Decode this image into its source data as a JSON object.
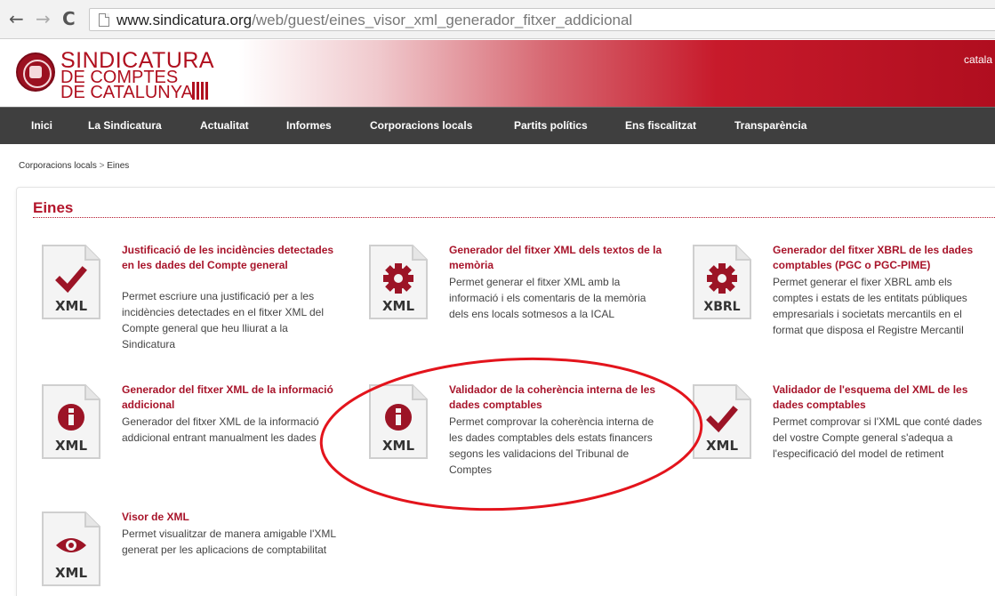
{
  "browser": {
    "back_glyph": "←",
    "forward_glyph": "→",
    "reload_glyph": "C",
    "url_host": "www.sindicatura.org",
    "url_path": "/web/guest/eines_visor_xml_generador_fitxer_addicional"
  },
  "header": {
    "logo_line1": "SINDICATURA",
    "logo_line2": "DE COMPTES",
    "logo_line3": "DE CATALUNYA",
    "language": "catala"
  },
  "nav": {
    "items": [
      {
        "label": "Inici"
      },
      {
        "label": "La Sindicatura"
      },
      {
        "label": "Actualitat"
      },
      {
        "label": "Informes"
      },
      {
        "label": "Corporacions locals"
      },
      {
        "label": "Partits polítics"
      },
      {
        "label": "Ens fiscalitzat"
      },
      {
        "label": "Transparència"
      }
    ]
  },
  "breadcrumb": {
    "parent": "Corporacions locals",
    "separator": ">",
    "current": "Eines"
  },
  "section": {
    "title": "Eines"
  },
  "tools": [
    {
      "icon": "check-icon",
      "format": "XML",
      "title": "Justificació de les incidències detectades en les dades del Compte general",
      "description": "Permet escriure una justificació per a les incidències detectades en el fitxer XML del Compte general que heu lliurat a la Sindicatura"
    },
    {
      "icon": "gear-icon",
      "format": "XML",
      "title": "Generador del fitxer XML dels textos de la memòria",
      "description": "Permet generar el fitxer XML amb la informació i els comentaris de la memòria dels ens locals sotmesos a la ICAL"
    },
    {
      "icon": "gear-icon",
      "format": "XBRL",
      "title": "Generador del fitxer XBRL de les dades comptables (PGC o PGC-PIME)",
      "description": "Permet generar el fixer XBRL amb els comptes i estats de les entitats públiques empresarials i societats mercantils en el format que disposa el Registre Mercantil"
    },
    {
      "icon": "info-icon",
      "format": "XML",
      "title": "Generador del fitxer XML de la informació addicional",
      "desc_line1": "Generador del fitxer XML de la informació",
      "desc_line2": "addicional entrant manualment les dades"
    },
    {
      "icon": "info-icon",
      "format": "XML",
      "title": "Validador de la coherència interna de les dades comptables",
      "description": "Permet comprovar la coherència interna de les dades comptables dels estats financers segons les validacions del Tribunal de Comptes"
    },
    {
      "icon": "check-icon",
      "format": "XML",
      "title": "Validador de l'esquema del XML de les dades comptables",
      "description": "Permet comprovar si l'XML que conté dades del vostre Compte general s'adequa a l'especificació del model de retiment"
    },
    {
      "icon": "eye-icon",
      "format": "XML",
      "title": "Visor de XML",
      "description": "Permet visualitzar de manera amigable l'XML generat per les aplicacions de comptabilitat"
    }
  ],
  "colors": {
    "brand_red": "#b3152b",
    "nav_bg": "#3f3f3f",
    "link_red": "#a8142a"
  }
}
